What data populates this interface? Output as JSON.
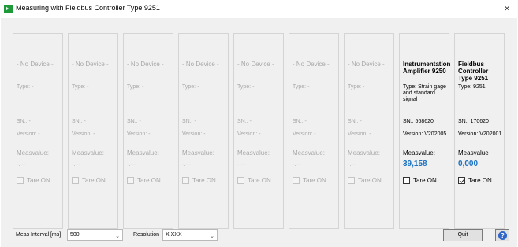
{
  "window": {
    "title": "Measuring with Fieldbus Controller Type 9251",
    "close_glyph": "×"
  },
  "panels": [
    {
      "name": "- No Device -",
      "type": "Type: -",
      "sn": "SN.: -",
      "version": "Version: -",
      "mv_label": "Measvalue:",
      "mv_value": "-.---",
      "tare_label": "Tare ON",
      "tare_checked": false,
      "enabled": false
    },
    {
      "name": "- No Device -",
      "type": "Type: -",
      "sn": "SN.: -",
      "version": "Version: -",
      "mv_label": "Measvalue:",
      "mv_value": "-.---",
      "tare_label": "Tare ON",
      "tare_checked": false,
      "enabled": false
    },
    {
      "name": "- No Device -",
      "type": "Type: -",
      "sn": "SN.: -",
      "version": "Version: -",
      "mv_label": "Measvalue:",
      "mv_value": "-.---",
      "tare_label": "Tare ON",
      "tare_checked": false,
      "enabled": false
    },
    {
      "name": "- No Device -",
      "type": "Type: -",
      "sn": "SN.: -",
      "version": "Version: -",
      "mv_label": "Measvalue:",
      "mv_value": "-.---",
      "tare_label": "Tare ON",
      "tare_checked": false,
      "enabled": false
    },
    {
      "name": "- No Device -",
      "type": "Type: -",
      "sn": "SN.: -",
      "version": "Version: -",
      "mv_label": "Measvalue:",
      "mv_value": "-.---",
      "tare_label": "Tare ON",
      "tare_checked": false,
      "enabled": false
    },
    {
      "name": "- No Device -",
      "type": "Type: -",
      "sn": "SN.: -",
      "version": "Version: -",
      "mv_label": "Measvalue:",
      "mv_value": "-.---",
      "tare_label": "Tare ON",
      "tare_checked": false,
      "enabled": false
    },
    {
      "name": "- No Device -",
      "type": "Type: -",
      "sn": "SN.: -",
      "version": "Version: -",
      "mv_label": "Measvalue:",
      "mv_value": "-.---",
      "tare_label": "Tare ON",
      "tare_checked": false,
      "enabled": false
    },
    {
      "name": "Instrumentation Amplifier 9250",
      "type": "Type: Strain gage and standard signal",
      "sn": "SN.: 568620",
      "version": "Version: V202005",
      "mv_label": "Measvalue:",
      "mv_value": "39,158",
      "tare_label": "Tare ON",
      "tare_checked": false,
      "enabled": true
    },
    {
      "name": "Fieldbus Controller Type 9251",
      "type": "Type: 9251",
      "sn": "SN.: 170620",
      "version": "Version: V202001",
      "mv_label": "Measvalue",
      "mv_value": "0,000",
      "tare_label": "Tare ON",
      "tare_checked": true,
      "enabled": true
    }
  ],
  "controls": {
    "interval_label": "Meas Interval [ms]",
    "interval_value": "500",
    "resolution_label": "Resolution",
    "resolution_value": "X,XXX",
    "quit_label": "Quit",
    "help_glyph": "?"
  },
  "colors": {
    "value_blue": "#1a72c2",
    "disabled_text": "#a8a8a8",
    "app_icon_green": "#1e9a3a"
  },
  "icons": {
    "app": "app-logo-icon",
    "close": "close-icon",
    "dropdown": "chevron-down-icon",
    "help": "help-icon"
  }
}
